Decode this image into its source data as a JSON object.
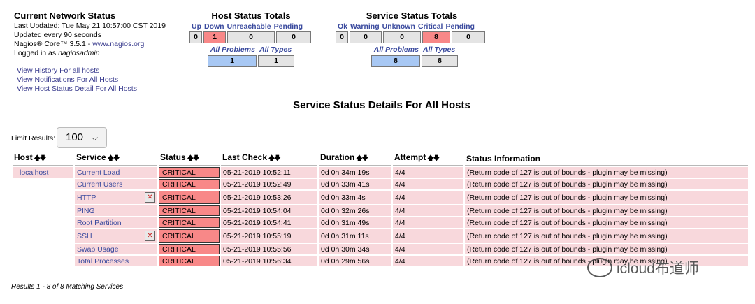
{
  "info": {
    "title": "Current Network Status",
    "last_updated": "Last Updated: Tue May 21 10:57:00 CST 2019",
    "update_interval": "Updated every 90 seconds",
    "version_text": "Nagios® Core™ 3.5.1 - ",
    "version_link": "www.nagios.org",
    "logged_in_prefix": "Logged in as ",
    "logged_in_user": "nagiosadmin"
  },
  "nav_links": [
    "View History For all hosts",
    "View Notifications For All Hosts",
    "View Host Status Detail For All Hosts"
  ],
  "host_totals": {
    "title": "Host Status Totals",
    "headers": [
      "Up",
      "Down",
      "Unreachable",
      "Pending"
    ],
    "values": [
      "0",
      "1",
      "0",
      "0"
    ],
    "all_problems_label": "All Problems",
    "all_types_label": "All Types",
    "all_problems": "1",
    "all_types": "1"
  },
  "service_totals": {
    "title": "Service Status Totals",
    "headers": [
      "Ok",
      "Warning",
      "Unknown",
      "Critical",
      "Pending"
    ],
    "values": [
      "0",
      "0",
      "0",
      "8",
      "0"
    ],
    "all_problems_label": "All Problems",
    "all_types_label": "All Types",
    "all_problems": "8",
    "all_types": "8"
  },
  "main_title": "Service Status Details For All Hosts",
  "limit": {
    "label": "Limit Results:",
    "value": "100"
  },
  "table": {
    "headers": [
      "Host",
      "Service",
      "Status",
      "Last Check",
      "Duration",
      "Attempt",
      "Status Information"
    ],
    "rows": [
      {
        "host": "localhost",
        "service": "Current Load",
        "status": "CRITICAL",
        "last_check": "05-21-2019 10:52:11",
        "duration": "0d 0h 34m 19s",
        "attempt": "4/4",
        "info": "(Return code of 127 is out of bounds - plugin may be missing)"
      },
      {
        "host": "",
        "service": "Current Users",
        "status": "CRITICAL",
        "last_check": "05-21-2019 10:52:49",
        "duration": "0d 0h 33m 41s",
        "attempt": "4/4",
        "info": "(Return code of 127 is out of bounds - plugin may be missing)"
      },
      {
        "host": "",
        "service": "HTTP",
        "status": "CRITICAL",
        "last_check": "05-21-2019 10:53:26",
        "duration": "0d 0h 33m 4s",
        "attempt": "4/4",
        "info": "(Return code of 127 is out of bounds - plugin may be missing)",
        "icon": "notifications-disabled-icon"
      },
      {
        "host": "",
        "service": "PING",
        "status": "CRITICAL",
        "last_check": "05-21-2019 10:54:04",
        "duration": "0d 0h 32m 26s",
        "attempt": "4/4",
        "info": "(Return code of 127 is out of bounds - plugin may be missing)"
      },
      {
        "host": "",
        "service": "Root Partition",
        "status": "CRITICAL",
        "last_check": "05-21-2019 10:54:41",
        "duration": "0d 0h 31m 49s",
        "attempt": "4/4",
        "info": "(Return code of 127 is out of bounds - plugin may be missing)"
      },
      {
        "host": "",
        "service": "SSH",
        "status": "CRITICAL",
        "last_check": "05-21-2019 10:55:19",
        "duration": "0d 0h 31m 11s",
        "attempt": "4/4",
        "info": "(Return code of 127 is out of bounds - plugin may be missing)",
        "icon": "notifications-disabled-icon"
      },
      {
        "host": "",
        "service": "Swap Usage",
        "status": "CRITICAL",
        "last_check": "05-21-2019 10:55:56",
        "duration": "0d 0h 30m 34s",
        "attempt": "4/4",
        "info": "(Return code of 127 is out of bounds - plugin may be missing)"
      },
      {
        "host": "",
        "service": "Total Processes",
        "status": "CRITICAL",
        "last_check": "05-21-2019 10:56:34",
        "duration": "0d 0h 29m 56s",
        "attempt": "4/4",
        "info": "(Return code of 127 is out of bounds - plugin may be missing)"
      }
    ]
  },
  "results_text": "Results 1 - 8 of 8 Matching Services",
  "watermark": "icloud布道师",
  "colors": {
    "critical": "#f88888",
    "row_bg": "#f8d8dc",
    "link": "#3a4a9e",
    "highlight_blue": "#a8c8f4"
  }
}
